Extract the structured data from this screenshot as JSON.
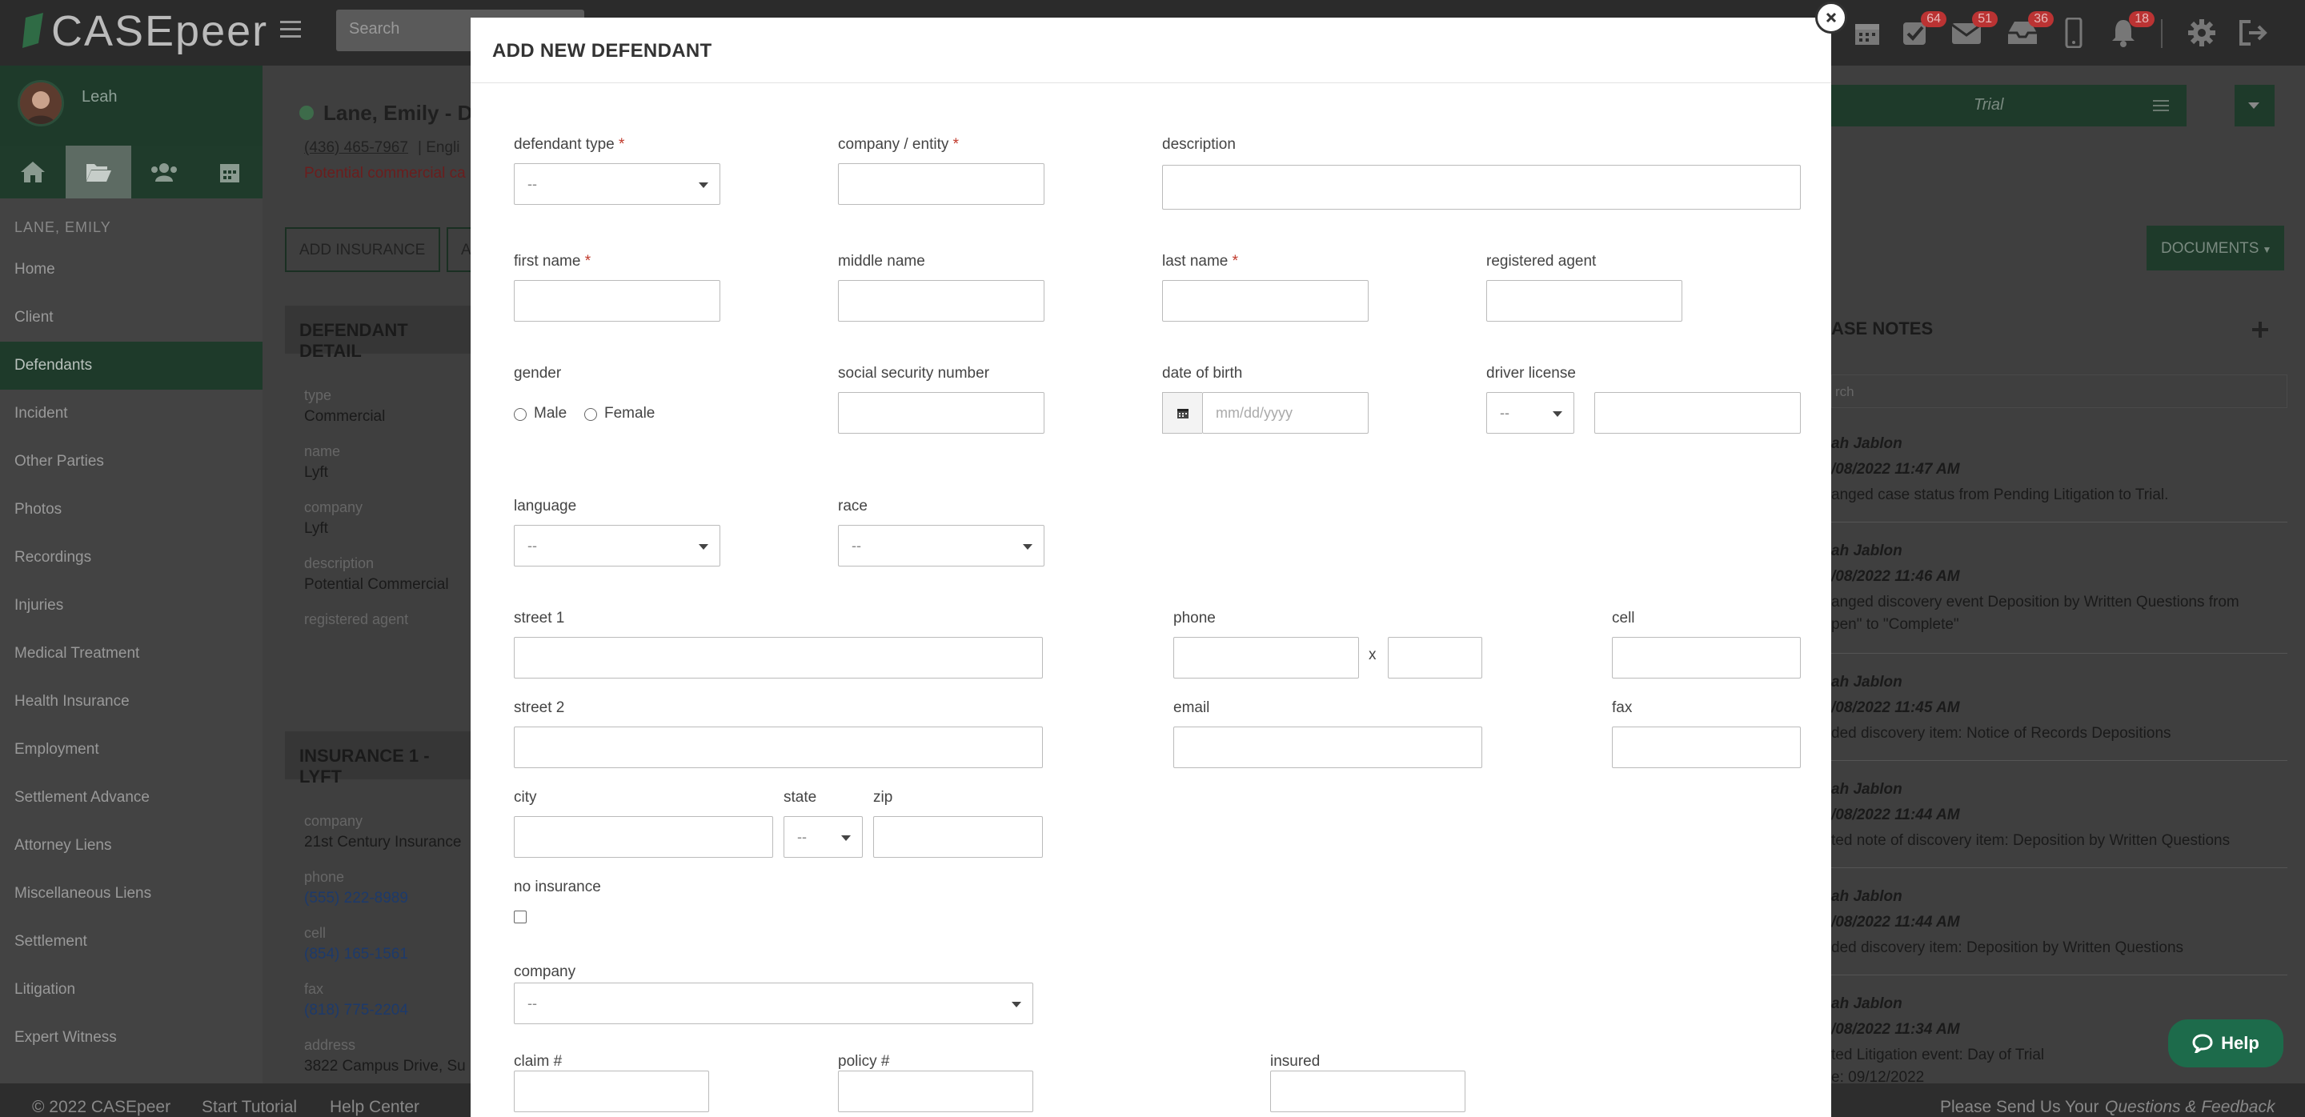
{
  "app": {
    "name": "CASEpeer",
    "search_placeholder": "Search"
  },
  "topbar": {
    "badges": {
      "tasks": "64",
      "mail": "51",
      "inbox": "36",
      "notifications": "18"
    }
  },
  "sidebar": {
    "user": "Leah",
    "case_name": "LANE, EMILY",
    "items": [
      {
        "label": "Home"
      },
      {
        "label": "Client"
      },
      {
        "label": "Defendants"
      },
      {
        "label": "Incident"
      },
      {
        "label": "Other Parties"
      },
      {
        "label": "Photos"
      },
      {
        "label": "Recordings"
      },
      {
        "label": "Injuries"
      },
      {
        "label": "Medical Treatment"
      },
      {
        "label": "Health Insurance"
      },
      {
        "label": "Employment"
      },
      {
        "label": "Settlement Advance"
      },
      {
        "label": "Attorney Liens"
      },
      {
        "label": "Miscellaneous Liens"
      },
      {
        "label": "Settlement"
      },
      {
        "label": "Litigation"
      },
      {
        "label": "Expert Witness"
      }
    ]
  },
  "background": {
    "case_title": "Lane, Emily - D",
    "phone": "(436) 465-7967",
    "lang": "| Engli",
    "potential": "Potential commercial ca",
    "add_insurance": "ADD INSURANCE",
    "add_other": "A",
    "defendant_details": "DEFENDANT DETAIL",
    "fields": [
      {
        "label": "type",
        "value": "Commercial"
      },
      {
        "label": "name",
        "value": "Lyft"
      },
      {
        "label": "company",
        "value": "Lyft"
      },
      {
        "label": "description",
        "value": "Potential Commercial"
      },
      {
        "label": "registered agent",
        "value": ""
      }
    ],
    "insurance_header": "INSURANCE 1 - LYFT",
    "insurance_fields": [
      {
        "label": "company",
        "value": "21st Century Insurance"
      },
      {
        "label": "phone",
        "value": "(555) 222-8989"
      },
      {
        "label": "cell",
        "value": "(854) 165-1561"
      },
      {
        "label": "fax",
        "value": "(818) 775-2204"
      },
      {
        "label": "address",
        "value": "3822 Campus Drive, Su"
      }
    ],
    "status": "Trial",
    "documents": "DOCUMENTS",
    "case_notes": "ASE NOTES",
    "notes_search": "rch",
    "notes": [
      {
        "author": "ah Jablon",
        "time": "/08/2022 11:47 AM",
        "text": "anged case status from Pending Litigation to Trial."
      },
      {
        "author": "ah Jablon",
        "time": "/08/2022 11:46 AM",
        "text": "anged discovery event Deposition by Written Questions from",
        "text2": "pen\" to \"Complete\""
      },
      {
        "author": "ah Jablon",
        "time": "/08/2022 11:45 AM",
        "text": "ded discovery item: Notice of Records Depositions"
      },
      {
        "author": "ah Jablon",
        "time": "/08/2022 11:44 AM",
        "text": "ted note of discovery item: Deposition by Written Questions"
      },
      {
        "author": "ah Jablon",
        "time": "/08/2022 11:44 AM",
        "text": "ded discovery item: Deposition by Written Questions"
      },
      {
        "author": "ah Jablon",
        "time": "/08/2022 11:34 AM",
        "text": "ted Litigation event: Day of Trial",
        "text2": "e: 09/12/2022"
      }
    ]
  },
  "modal": {
    "title": "ADD NEW DEFENDANT",
    "labels": {
      "defendant_type": "defendant type",
      "company_entity": "company / entity",
      "description": "description",
      "first_name": "first name",
      "middle_name": "middle name",
      "last_name": "last name",
      "registered_agent": "registered agent",
      "gender": "gender",
      "ssn": "social security number",
      "dob": "date of birth",
      "driver_license": "driver license",
      "language": "language",
      "race": "race",
      "street1": "street 1",
      "phone": "phone",
      "cell": "cell",
      "street2": "street 2",
      "email": "email",
      "fax": "fax",
      "city": "city",
      "state": "state",
      "zip": "zip",
      "no_insurance": "no insurance",
      "company": "company",
      "claim": "claim #",
      "policy": "policy #",
      "insured": "insured"
    },
    "required_mark": "*",
    "gender_options": {
      "male": "Male",
      "female": "Female"
    },
    "select_default": "--",
    "dob_placeholder": "mm/dd/yyyy",
    "ext_separator": "x"
  },
  "footer": {
    "copyright": "© 2022 CASEpeer",
    "tutorial": "Start Tutorial",
    "help_center": "Help Center",
    "feedback_prefix": "Please Send Us Your",
    "feedback_link": "Questions & Feedback"
  },
  "help": {
    "label": "Help"
  }
}
